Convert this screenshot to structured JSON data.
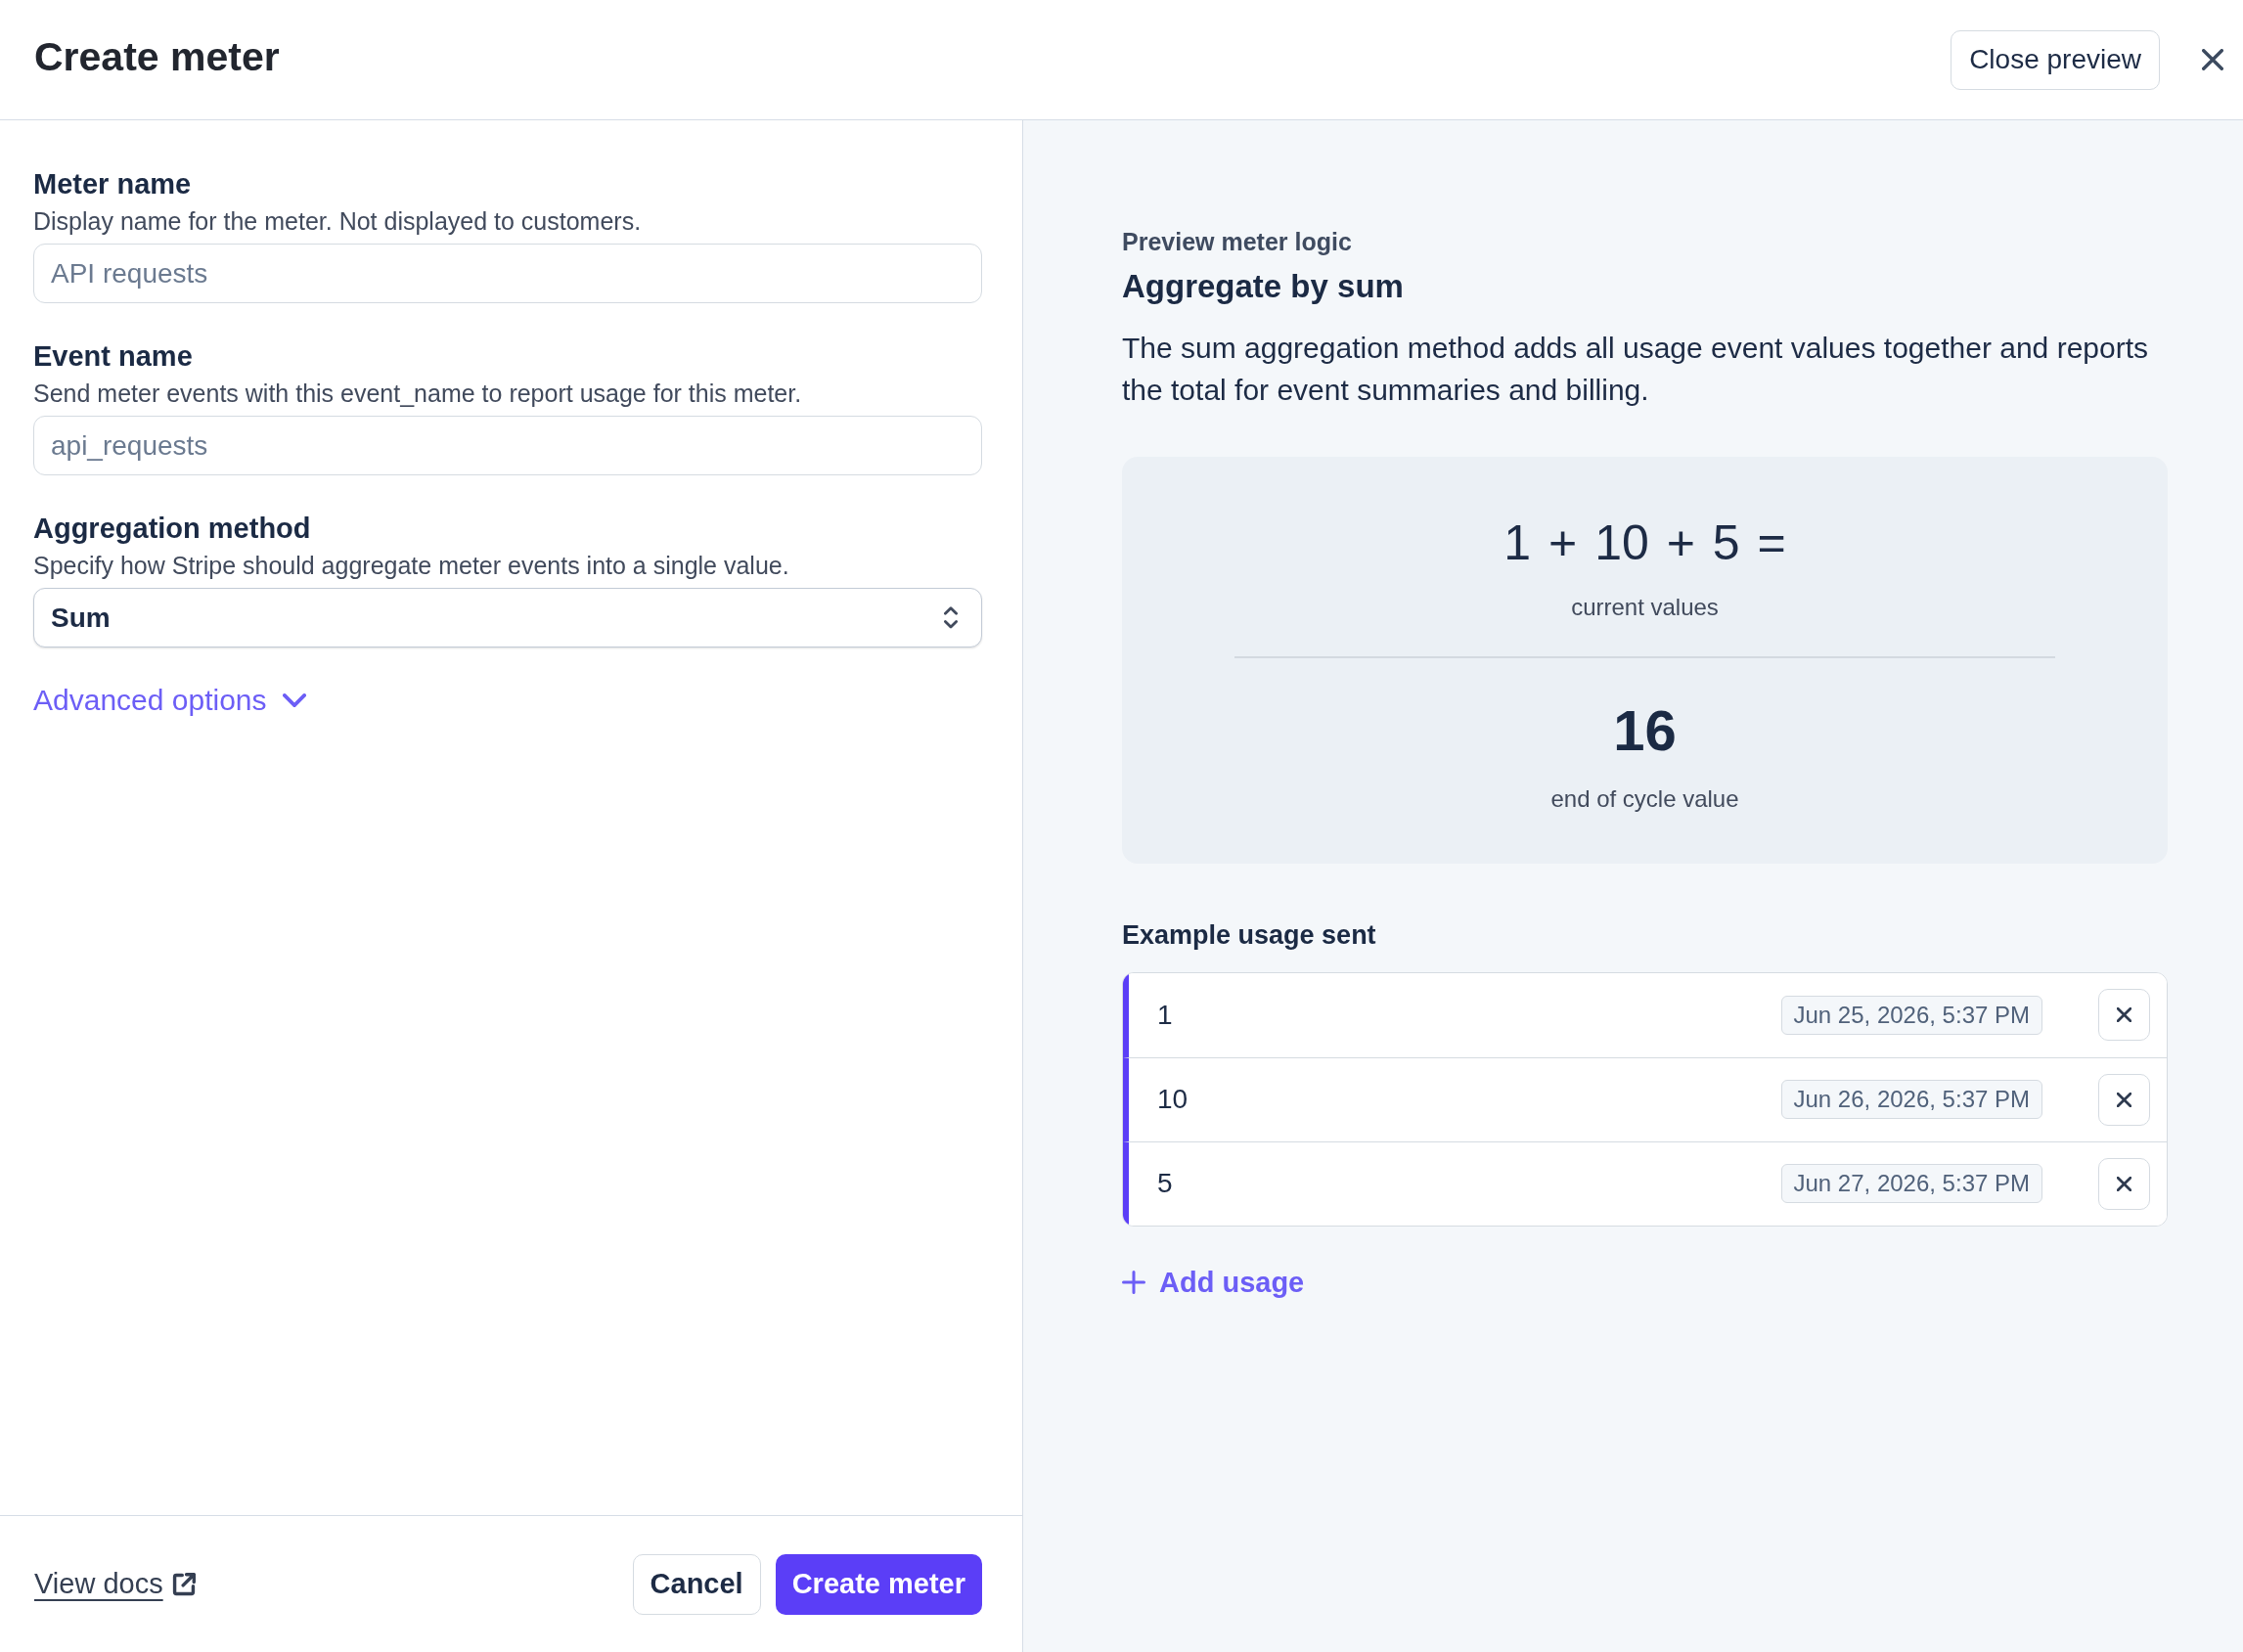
{
  "header": {
    "title": "Create meter",
    "close_preview_button": "Close preview"
  },
  "form": {
    "fields": [
      {
        "kind": "text",
        "label": "Meter name",
        "description": "Display name for the meter. Not displayed to customers.",
        "placeholder": "API requests"
      },
      {
        "kind": "text",
        "label": "Event name",
        "description": "Send meter events with this event_name to report usage for this meter.",
        "placeholder": "api_requests"
      },
      {
        "kind": "select",
        "label": "Aggregation method",
        "description": "Specify how Stripe should aggregate meter events into a single value.",
        "value": "Sum"
      }
    ],
    "advanced_options": {
      "label": "Advanced options",
      "expanded": false
    }
  },
  "footer": {
    "docs_link": "View docs",
    "buttons": [
      {
        "label": "Cancel",
        "kind": "secondary"
      },
      {
        "label": "Create meter",
        "kind": "primary"
      }
    ]
  },
  "preview": {
    "eyebrow": "Preview meter logic",
    "title": "Aggregate by sum",
    "description": "The sum aggregation method adds all usage event values together and reports the total for event summaries and billing.",
    "calculation": {
      "expression": "1 + 10 + 5 =",
      "expression_caption": "current values",
      "result": "16",
      "result_caption": "end of cycle value"
    },
    "usage": {
      "title": "Example usage sent",
      "rows": [
        {
          "value": "1",
          "timestamp": "Jun 25, 2026, 5:37 PM"
        },
        {
          "value": "10",
          "timestamp": "Jun 26, 2026, 5:37 PM"
        },
        {
          "value": "5",
          "timestamp": "Jun 27, 2026, 5:37 PM"
        }
      ],
      "add_label": "Add usage"
    }
  }
}
